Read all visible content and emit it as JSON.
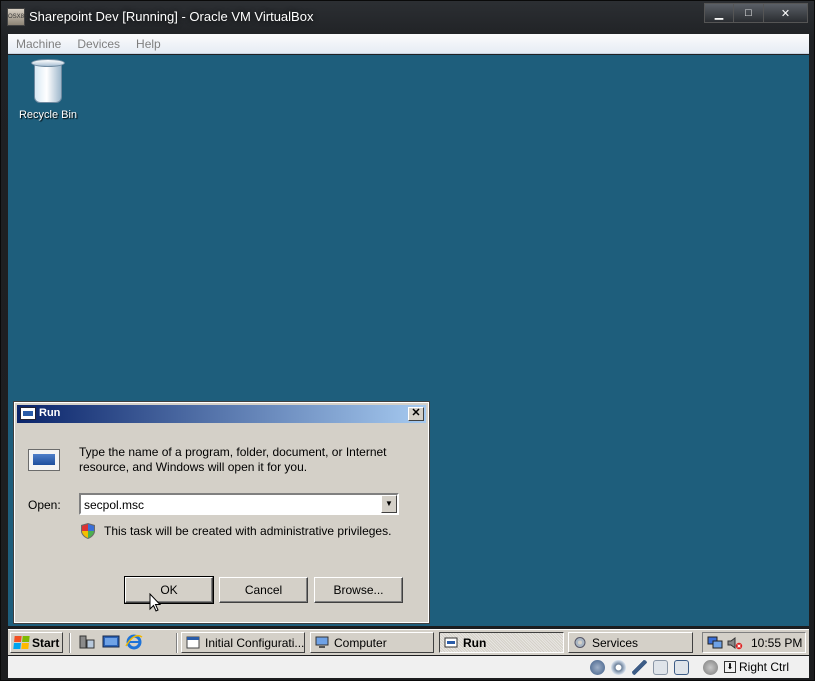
{
  "host": {
    "title": "Sharepoint Dev [Running] - Oracle VM VirtualBox",
    "controls": {
      "minimize": "▁",
      "maximize": "□",
      "close": "✕"
    },
    "app_icon_text": "OSX86",
    "menu": [
      "Machine",
      "Devices",
      "Help"
    ],
    "statusbar": {
      "icons": [
        "hard-disk-icon",
        "optical-drive-icon",
        "usb-icon",
        "shared-folders-icon",
        "network-icon",
        "display-icon",
        "mouse-integration-icon"
      ],
      "host_key_label": "Right Ctrl"
    }
  },
  "desktop": {
    "background": "#1e5e7c",
    "icons": [
      {
        "label": "Recycle Bin",
        "icon": "recycle-bin-icon"
      }
    ]
  },
  "run_dialog": {
    "title": "Run",
    "prompt": "Type the name of a program, folder, document, or Internet resource, and Windows will open it for you.",
    "open_label": "Open:",
    "open_value": "secpol.msc",
    "admin_note": "This task will be created with administrative privileges.",
    "buttons": {
      "ok": "OK",
      "cancel": "Cancel",
      "browse": "Browse..."
    },
    "close_glyph": "✕"
  },
  "taskbar": {
    "start_label": "Start",
    "quick_launch": [
      "server-manager-icon",
      "show-desktop-icon",
      "internet-explorer-icon"
    ],
    "tasks": [
      {
        "label": "Initial Configurati...",
        "active": false
      },
      {
        "label": "Computer",
        "active": false
      },
      {
        "label": "Run",
        "active": true
      },
      {
        "label": "Services",
        "active": false
      }
    ],
    "tray_icons": [
      "network-tray-icon",
      "volume-muted-icon"
    ],
    "clock": "10:55 PM"
  }
}
